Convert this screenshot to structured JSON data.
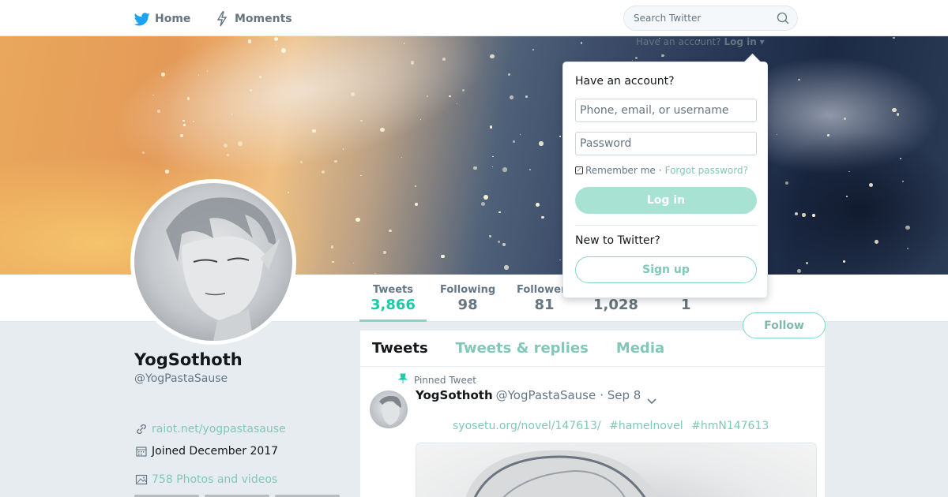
{
  "nav": {
    "home_label": "Home",
    "moments_label": "Moments",
    "search_placeholder": "Search Twitter",
    "home_icon": "twitter-bird-icon",
    "moments_icon": "lightning-icon",
    "search_icon": "search-icon"
  },
  "login_hint": {
    "prefix": "Have an account?",
    "link": "Log in"
  },
  "login_dropdown": {
    "title": "Have an account?",
    "username_placeholder": "Phone, email, or username",
    "password_placeholder": "Password",
    "remember_label": "Remember me",
    "separator": "·",
    "forgot_label": "Forgot password?",
    "login_button": "Log in",
    "new_label": "New to Twitter?",
    "signup_button": "Sign up"
  },
  "stats": [
    {
      "label": "Tweets",
      "value": "3,866"
    },
    {
      "label": "Following",
      "value": "98"
    },
    {
      "label": "Followers",
      "value": "81"
    },
    {
      "label": "",
      "value": "1,028"
    },
    {
      "label": "",
      "value": "1"
    }
  ],
  "follow_button": "Follow",
  "profile": {
    "name": "YogSothoth",
    "handle": "@YogPastaSause",
    "website": "raiot.net/yogpastasause",
    "joined": "Joined December 2017",
    "media": "758 Photos and videos"
  },
  "tabs": [
    "Tweets",
    "Tweets & replies",
    "Media"
  ],
  "tweet": {
    "pinned_label": "Pinned Tweet",
    "name": "YogSothoth",
    "handle": "@YogPastaSause",
    "date": "· Sep 8",
    "link1": "syosetu.org/novel/147613/",
    "hashtag1": "#hamelnovel",
    "hashtag2": "#hmN147613"
  },
  "colors": {
    "accent": "#1dcaa8",
    "accent_light": "#80c8b8",
    "login_button_bg": "#a8e2d3"
  }
}
